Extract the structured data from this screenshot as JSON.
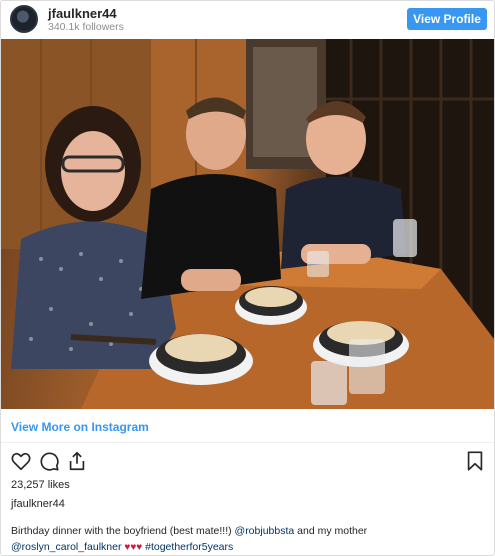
{
  "header": {
    "username": "jfaulkner44",
    "followers": "340.1k followers",
    "view_profile": "View Profile"
  },
  "photo": {
    "description_icon": "photo"
  },
  "view_more": "View More on Instagram",
  "actions": {
    "like_icon": "heart-outline-icon",
    "comment_icon": "comment-bubble-icon",
    "share_icon": "share-icon",
    "save_icon": "bookmark-icon"
  },
  "likes": "23,257 likes",
  "owner": "jfaulkner44",
  "caption": {
    "text_1": "Birthday dinner with the boyfriend (best mate!!!) ",
    "mention_1": "@robjubbsta",
    "text_2": " and my mother",
    "mention_2": "@roslyn_carol_faulkner",
    "hearts": "♥♥♥",
    "hashtag": "#togetherfor5years"
  },
  "colors": {
    "accent": "#3897f0",
    "link": "#003569",
    "heart": "#d11a3b"
  }
}
